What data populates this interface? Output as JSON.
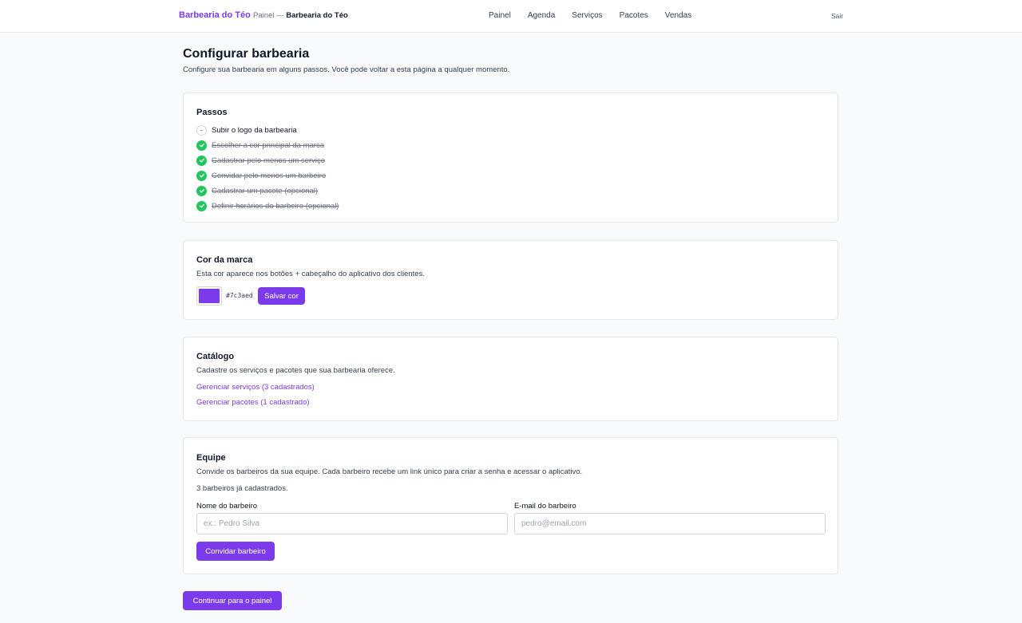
{
  "header": {
    "brand": "Barbearia do Téo",
    "crumb_prefix": "Painel —",
    "crumb_current": "Barbearia do Téo",
    "nav": [
      "Painel",
      "Agenda",
      "Serviços",
      "Pacotes",
      "Vendas"
    ],
    "signout": "Sair"
  },
  "page": {
    "title": "Configurar barbearia",
    "subtitle": "Configure sua barbearia em alguns passos. Você pode voltar a esta página a qualquer momento."
  },
  "steps": {
    "title": "Passos",
    "items": [
      {
        "label": "Subir o logo da barbearia",
        "done": false
      },
      {
        "label": "Escolher a cor principal da marca",
        "done": true
      },
      {
        "label": "Cadastrar pelo menos um serviço",
        "done": true
      },
      {
        "label": "Convidar pelo menos um barbeiro",
        "done": true
      },
      {
        "label": "Cadastrar um pacote (opcional)",
        "done": true
      },
      {
        "label": "Definir horários do barbeiro (opcional)",
        "done": true
      }
    ]
  },
  "brand_color": {
    "title": "Cor da marca",
    "description": "Esta cor aparece nos botões + cabeçalho do aplicativo dos clientes.",
    "value": "#7c3aed",
    "save_label": "Salvar cor"
  },
  "catalog": {
    "title": "Catálogo",
    "description": "Cadastre os serviços e pacotes que sua barbearia oferece.",
    "services_link": "Gerenciar serviços (3 cadastrados)",
    "packages_link": "Gerenciar pacotes (1 cadastrado)"
  },
  "team": {
    "title": "Equipe",
    "description": "Convide os barbeiros da sua equipe. Cada barbeiro recebe um link único para criar a senha e acessar o aplicativo.",
    "count_text": "3 barbeiros já cadastrados.",
    "name_label": "Nome do barbeiro",
    "name_placeholder": "ex.: Pedro Silva",
    "email_label": "E-mail do barbeiro",
    "email_placeholder": "pedro@email.com",
    "invite_label": "Convidar barbeiro"
  },
  "continue_label": "Continuar para o painel",
  "colors": {
    "accent": "#7c3aed",
    "success": "#22c55e"
  }
}
